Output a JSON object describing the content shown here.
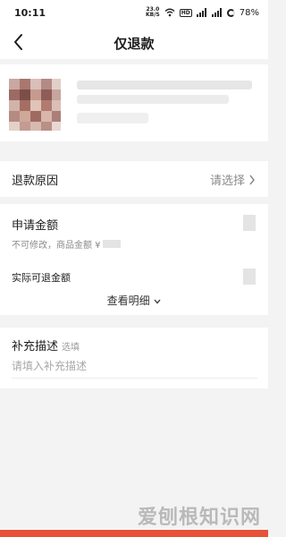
{
  "status_bar": {
    "time": "10:11",
    "net_speed": "23.0",
    "net_unit": "KB/S",
    "hd_badge": "HD",
    "battery": "78%"
  },
  "header": {
    "title": "仅退款",
    "back_icon": "chevron-left-icon"
  },
  "reason": {
    "label": "退款原因",
    "hint": "请选择"
  },
  "amount": {
    "label": "申请金额",
    "note": "不可修改，商品金额 ¥",
    "actual_label": "实际可退金额",
    "detail_link": "查看明细"
  },
  "description": {
    "label": "补充描述",
    "optional": "选填",
    "placeholder": "请填入补充描述"
  },
  "watermark": "爱刨根知识网",
  "colors": {
    "accent": "#e8503a",
    "background": "#f3f3f3"
  }
}
